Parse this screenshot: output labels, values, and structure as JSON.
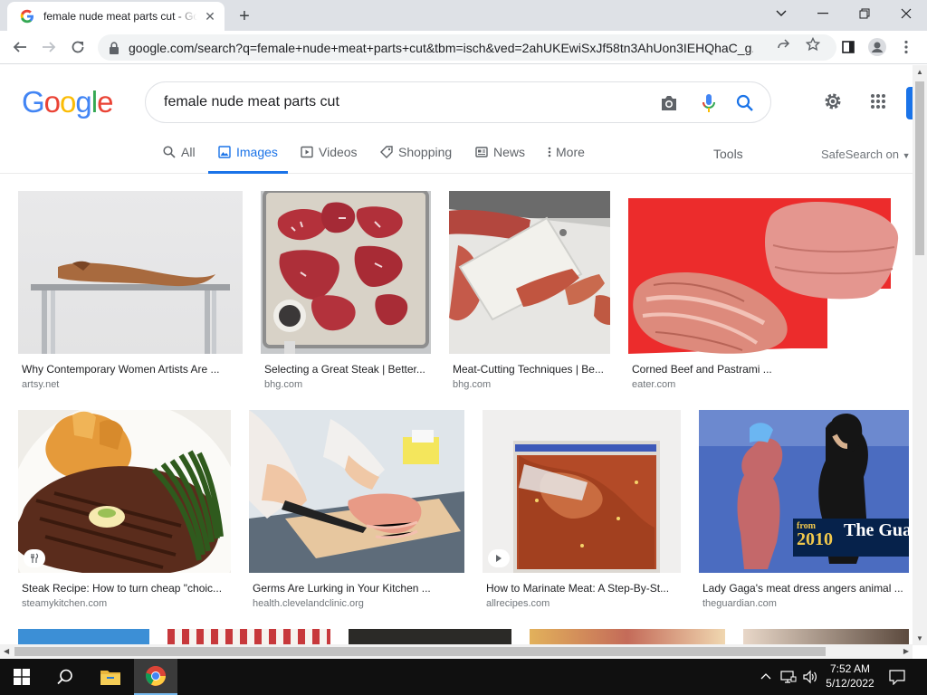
{
  "browser": {
    "tab_title": "female nude meat parts cut - Google Search",
    "url": "google.com/search?q=female+nude+meat+parts+cut&tbm=isch&ved=2ahUKEwiSxJf58tn3AhUon3IEHQhaC_g..."
  },
  "google": {
    "logo": {
      "letters": [
        "G",
        "o",
        "o",
        "g",
        "l",
        "e"
      ],
      "colors": [
        "#4285f4",
        "#ea4335",
        "#fbbc05",
        "#4285f4",
        "#34a853",
        "#ea4335"
      ]
    },
    "query": "female nude meat parts cut",
    "tabs": [
      {
        "label": "All",
        "icon": "search-icon",
        "active": false
      },
      {
        "label": "Images",
        "icon": "image-icon",
        "active": true
      },
      {
        "label": "Videos",
        "icon": "video-icon",
        "active": false
      },
      {
        "label": "Shopping",
        "icon": "tag-icon",
        "active": false
      },
      {
        "label": "News",
        "icon": "news-icon",
        "active": false
      },
      {
        "label": "More",
        "icon": "more-vert-icon",
        "active": false
      }
    ],
    "tools_label": "Tools",
    "safesearch_label": "SafeSearch on"
  },
  "results": [
    {
      "caption": "Why Contemporary Women Artists Are ...",
      "source": "artsy.net"
    },
    {
      "caption": "Selecting a Great Steak | Better...",
      "source": "bhg.com"
    },
    {
      "caption": "Meat-Cutting Techniques | Be...",
      "source": "bhg.com"
    },
    {
      "caption": "Corned Beef and Pastrami ...",
      "source": "eater.com"
    },
    {
      "caption": "Steak Recipe: How to turn cheap \"choic...",
      "source": "steamykitchen.com"
    },
    {
      "caption": "Germs Are Lurking in Your Kitchen ...",
      "source": "health.clevelandclinic.org"
    },
    {
      "caption": "How to Marinate Meat: A Step-By-St...",
      "source": "allrecipes.com"
    },
    {
      "caption": "Lady Gaga's meat dress angers animal ...",
      "source": "theguardian.com"
    }
  ],
  "image_overlays": {
    "guardian_year_prefix": "from",
    "guardian_year": "2010",
    "guardian_brand": "The Guardi"
  },
  "taskbar": {
    "time": "7:52 AM",
    "date": "5/12/2022"
  }
}
